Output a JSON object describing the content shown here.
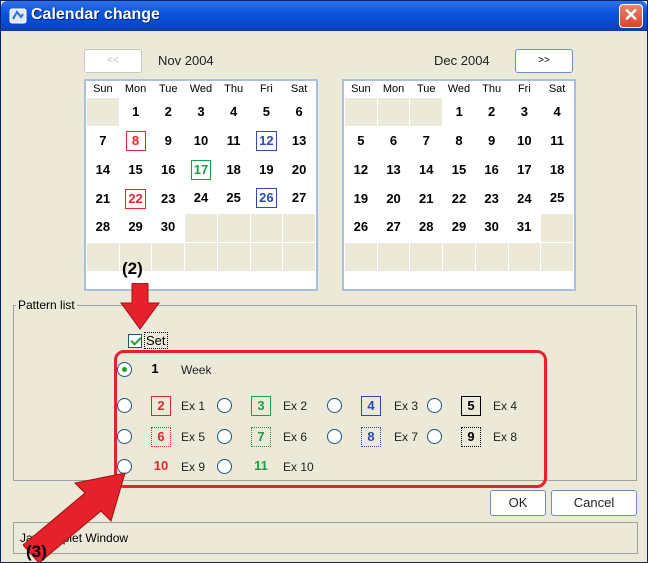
{
  "window": {
    "title": "Calendar change",
    "close_symbol": "✕"
  },
  "nav": {
    "prev_label": "<<",
    "next_label": ">>"
  },
  "months": [
    {
      "name": "Nov 2004",
      "weekdays": [
        "Sun",
        "Mon",
        "Tue",
        "Wed",
        "Thu",
        "Fri",
        "Sat"
      ],
      "weeks": [
        [
          {
            "d": ""
          },
          {
            "d": "1"
          },
          {
            "d": "2"
          },
          {
            "d": "3"
          },
          {
            "d": "4"
          },
          {
            "d": "5"
          },
          {
            "d": "6"
          }
        ],
        [
          {
            "d": "7"
          },
          {
            "d": "8",
            "s": "b-red"
          },
          {
            "d": "9"
          },
          {
            "d": "10"
          },
          {
            "d": "11"
          },
          {
            "d": "12",
            "s": "b-blue"
          },
          {
            "d": "13"
          }
        ],
        [
          {
            "d": "14"
          },
          {
            "d": "15"
          },
          {
            "d": "16"
          },
          {
            "d": "17",
            "s": "b-green"
          },
          {
            "d": "18"
          },
          {
            "d": "19"
          },
          {
            "d": "20"
          }
        ],
        [
          {
            "d": "21"
          },
          {
            "d": "22",
            "s": "b-red"
          },
          {
            "d": "23"
          },
          {
            "d": "24"
          },
          {
            "d": "25"
          },
          {
            "d": "26",
            "s": "b-blue"
          },
          {
            "d": "27"
          }
        ],
        [
          {
            "d": "28"
          },
          {
            "d": "29"
          },
          {
            "d": "30"
          },
          {
            "d": ""
          },
          {
            "d": ""
          },
          {
            "d": ""
          },
          {
            "d": ""
          }
        ],
        [
          {
            "d": ""
          },
          {
            "d": ""
          },
          {
            "d": ""
          },
          {
            "d": ""
          },
          {
            "d": ""
          },
          {
            "d": ""
          },
          {
            "d": ""
          }
        ]
      ]
    },
    {
      "name": "Dec 2004",
      "weekdays": [
        "Sun",
        "Mon",
        "Tue",
        "Wed",
        "Thu",
        "Fri",
        "Sat"
      ],
      "weeks": [
        [
          {
            "d": ""
          },
          {
            "d": ""
          },
          {
            "d": ""
          },
          {
            "d": "1"
          },
          {
            "d": "2"
          },
          {
            "d": "3"
          },
          {
            "d": "4"
          }
        ],
        [
          {
            "d": "5"
          },
          {
            "d": "6"
          },
          {
            "d": "7"
          },
          {
            "d": "8"
          },
          {
            "d": "9"
          },
          {
            "d": "10"
          },
          {
            "d": "11"
          }
        ],
        [
          {
            "d": "12"
          },
          {
            "d": "13"
          },
          {
            "d": "14"
          },
          {
            "d": "15"
          },
          {
            "d": "16"
          },
          {
            "d": "17"
          },
          {
            "d": "18"
          }
        ],
        [
          {
            "d": "19"
          },
          {
            "d": "20"
          },
          {
            "d": "21"
          },
          {
            "d": "22"
          },
          {
            "d": "23"
          },
          {
            "d": "24"
          },
          {
            "d": "25"
          }
        ],
        [
          {
            "d": "26"
          },
          {
            "d": "27"
          },
          {
            "d": "28"
          },
          {
            "d": "29"
          },
          {
            "d": "30"
          },
          {
            "d": "31"
          },
          {
            "d": ""
          }
        ],
        [
          {
            "d": ""
          },
          {
            "d": ""
          },
          {
            "d": ""
          },
          {
            "d": ""
          },
          {
            "d": ""
          },
          {
            "d": ""
          },
          {
            "d": ""
          }
        ]
      ]
    }
  ],
  "pattern_list": {
    "group_label": "Pattern list",
    "set_label": "Set",
    "set_checked": true,
    "selected": "1",
    "patterns": [
      {
        "num": "1",
        "label": "Week",
        "style": "plain-black"
      },
      {
        "num": "2",
        "label": "Ex 1",
        "style": "solid-red"
      },
      {
        "num": "3",
        "label": "Ex 2",
        "style": "solid-green"
      },
      {
        "num": "4",
        "label": "Ex 3",
        "style": "solid-blue"
      },
      {
        "num": "5",
        "label": "Ex 4",
        "style": "solid-black"
      },
      {
        "num": "6",
        "label": "Ex 5",
        "style": "dot-red"
      },
      {
        "num": "7",
        "label": "Ex 6",
        "style": "dot-green"
      },
      {
        "num": "8",
        "label": "Ex 7",
        "style": "dot-blue"
      },
      {
        "num": "9",
        "label": "Ex 8",
        "style": "dot-black"
      },
      {
        "num": "10",
        "label": "Ex 9",
        "style": "plain-red"
      },
      {
        "num": "11",
        "label": "Ex 10",
        "style": "plain-green"
      }
    ]
  },
  "buttons": {
    "ok": "OK",
    "cancel": "Cancel"
  },
  "status": {
    "text": "Java Applet Window"
  },
  "annotations": {
    "label_2": "(2)",
    "label_3": "(3)"
  },
  "colors": {
    "title_bar": "#0a55e0",
    "arrow": "#e5222b",
    "highlight": "#e5222b"
  },
  "icons": {
    "title": "applet-icon",
    "close": "close-icon"
  }
}
